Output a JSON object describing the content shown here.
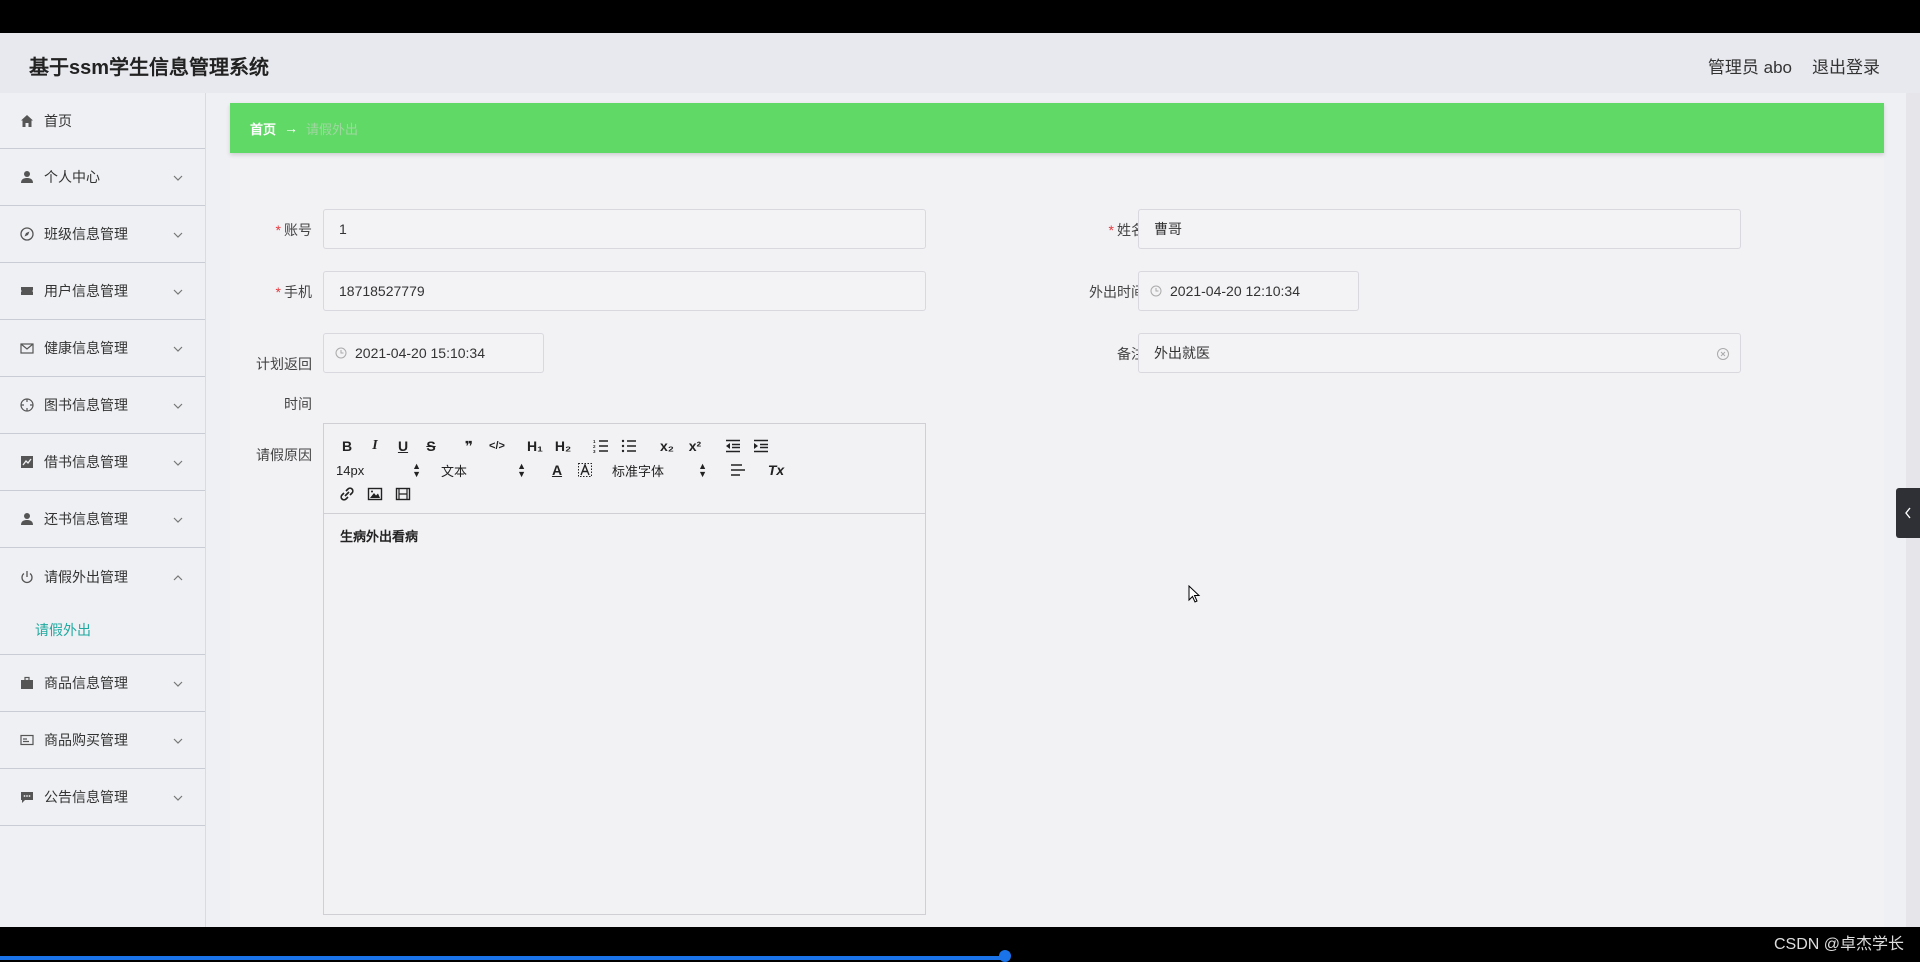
{
  "header": {
    "title": "基于ssm学生信息管理系统",
    "user": "管理员 abo",
    "logout": "退出登录"
  },
  "sidebar": {
    "items": [
      {
        "label": "首页",
        "icon": "home-icon"
      },
      {
        "label": "个人中心",
        "icon": "user-icon"
      },
      {
        "label": "班级信息管理",
        "icon": "compass-icon"
      },
      {
        "label": "用户信息管理",
        "icon": "ticket-icon"
      },
      {
        "label": "健康信息管理",
        "icon": "mail-icon"
      },
      {
        "label": "图书信息管理",
        "icon": "target-icon"
      },
      {
        "label": "借书信息管理",
        "icon": "chart-icon"
      },
      {
        "label": "还书信息管理",
        "icon": "user-icon"
      },
      {
        "label": "请假外出管理",
        "icon": "power-icon"
      },
      {
        "label": "商品信息管理",
        "icon": "briefcase-icon"
      },
      {
        "label": "商品购买管理",
        "icon": "card-icon"
      },
      {
        "label": "公告信息管理",
        "icon": "message-icon"
      }
    ],
    "subitem": "请假外出"
  },
  "breadcrumb": {
    "home": "首页",
    "arrow": "→",
    "current": "请假外出"
  },
  "form": {
    "account_label": "账号",
    "account_value": "1",
    "name_label": "姓名",
    "name_value": "曹哥",
    "phone_label": "手机",
    "phone_value": "18718527779",
    "out_time_label": "外出时间",
    "out_time_value": "2021-04-20 12:10:34",
    "return_label_1": "计划返回",
    "return_label_2": "时间",
    "return_value": "2021-04-20 15:10:34",
    "note_label": "备注",
    "note_value": "外出就医",
    "reason_label": "请假原因",
    "required_mark": "*"
  },
  "editor": {
    "font_size": "14px",
    "block_type": "文本",
    "font_family": "标准字体",
    "content": "生病外出看病",
    "buttons": {
      "bold": "B",
      "italic": "I",
      "underline": "U",
      "strike": "S",
      "quote": "❞",
      "code": "</>",
      "h1": "H₁",
      "h2": "H₂",
      "sub": "x₂",
      "sup": "x²",
      "color": "A",
      "clean": "Tx"
    }
  },
  "watermark": "CSDN @卓杰学长"
}
